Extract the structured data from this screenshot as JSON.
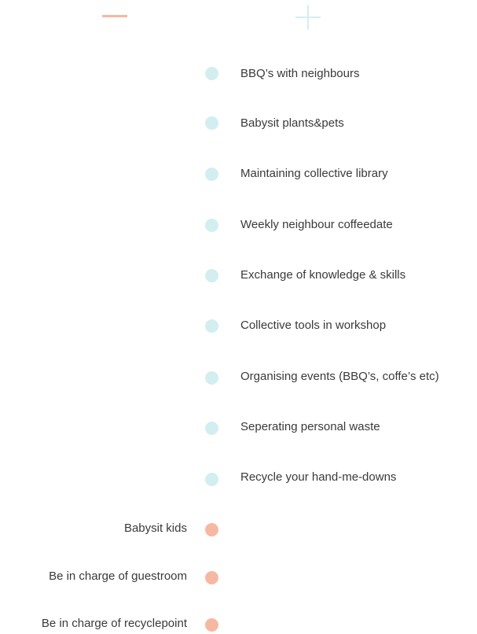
{
  "colors": {
    "plus": "#d3eef1",
    "minus": "#f7b8a2",
    "text": "#3a3a3a"
  },
  "plus_items": [
    {
      "label": "BBQ’s with neighbours"
    },
    {
      "label": "Babysit plants&pets"
    },
    {
      "label": "Maintaining collective library"
    },
    {
      "label": "Weekly neighbour coffeedate"
    },
    {
      "label": "Exchange of knowledge & skills"
    },
    {
      "label": "Collective tools in workshop"
    },
    {
      "label": "Organising events (BBQ’s, coffe’s etc)"
    },
    {
      "label": "Seperating personal waste"
    },
    {
      "label": "Recycle your hand-me-downs"
    }
  ],
  "minus_items": [
    {
      "label": "Babysit kids"
    },
    {
      "label": "Be in charge of guestroom"
    },
    {
      "label": "Be in charge of recyclepoint"
    }
  ]
}
